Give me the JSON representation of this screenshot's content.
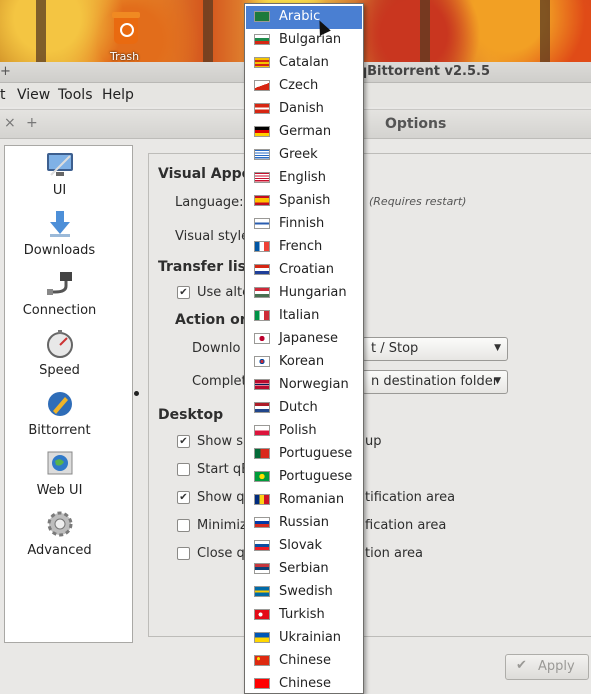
{
  "desktop": {
    "trash_label": "Trash"
  },
  "window": {
    "app_title": "qBittorrent v2.5.5",
    "app_menu_glyph": "+",
    "menu": [
      "t",
      "View",
      "Tools",
      "Help"
    ]
  },
  "dialog": {
    "title": "Options",
    "close_glyph": "×",
    "pin_glyph": "+",
    "categories": [
      {
        "label": "UI",
        "icon": "ui-icon"
      },
      {
        "label": "Downloads",
        "icon": "downloads-icon"
      },
      {
        "label": "Connection",
        "icon": "connection-icon"
      },
      {
        "label": "Speed",
        "icon": "speed-icon"
      },
      {
        "label": "Bittorrent",
        "icon": "bittorrent-icon"
      },
      {
        "label": "Web UI",
        "icon": "web-ui-icon"
      },
      {
        "label": "Advanced",
        "icon": "advanced-icon"
      }
    ],
    "settings": {
      "visual_section": "Visual Appear",
      "language_label": "Language:",
      "requires_restart": "(Requires restart)",
      "visual_style_label": "Visual style:",
      "transfer_section": "Transfer list",
      "use_alt_label": "Use alte",
      "action_heading": "Action on d",
      "download_label": "Downlo",
      "download_value": "t / Stop",
      "completed_label": "Complet",
      "completed_value": "n destination folder",
      "desktop_section": "Desktop",
      "desktop_options": [
        {
          "left": "Show sp",
          "right": "up",
          "checked": true
        },
        {
          "left": "Start qE",
          "right": "",
          "checked": false
        },
        {
          "left": "Show qE",
          "right": "tification area",
          "checked": true
        },
        {
          "left": "Minimiz",
          "right": "fication area",
          "checked": false
        },
        {
          "left": "Close qE",
          "right": "tion area",
          "checked": false
        }
      ]
    },
    "apply_label": "Apply",
    "checkmark": "✔"
  },
  "languages": [
    {
      "name": "Arabic",
      "selected": true
    },
    {
      "name": "Bulgarian"
    },
    {
      "name": "Catalan"
    },
    {
      "name": "Czech"
    },
    {
      "name": "Danish"
    },
    {
      "name": "German"
    },
    {
      "name": "Greek"
    },
    {
      "name": "English"
    },
    {
      "name": "Spanish"
    },
    {
      "name": "Finnish"
    },
    {
      "name": "French"
    },
    {
      "name": "Croatian"
    },
    {
      "name": "Hungarian"
    },
    {
      "name": "Italian"
    },
    {
      "name": "Japanese"
    },
    {
      "name": "Korean"
    },
    {
      "name": "Norwegian"
    },
    {
      "name": "Dutch"
    },
    {
      "name": "Polish"
    },
    {
      "name": "Portuguese"
    },
    {
      "name": "Portuguese"
    },
    {
      "name": "Romanian"
    },
    {
      "name": "Russian"
    },
    {
      "name": "Slovak"
    },
    {
      "name": "Serbian"
    },
    {
      "name": "Swedish"
    },
    {
      "name": "Turkish"
    },
    {
      "name": "Ukrainian"
    },
    {
      "name": "Chinese"
    },
    {
      "name": "Chinese"
    }
  ],
  "colors": {
    "selection": "#4a7fd2",
    "window_bg": "#e9e8e6"
  }
}
